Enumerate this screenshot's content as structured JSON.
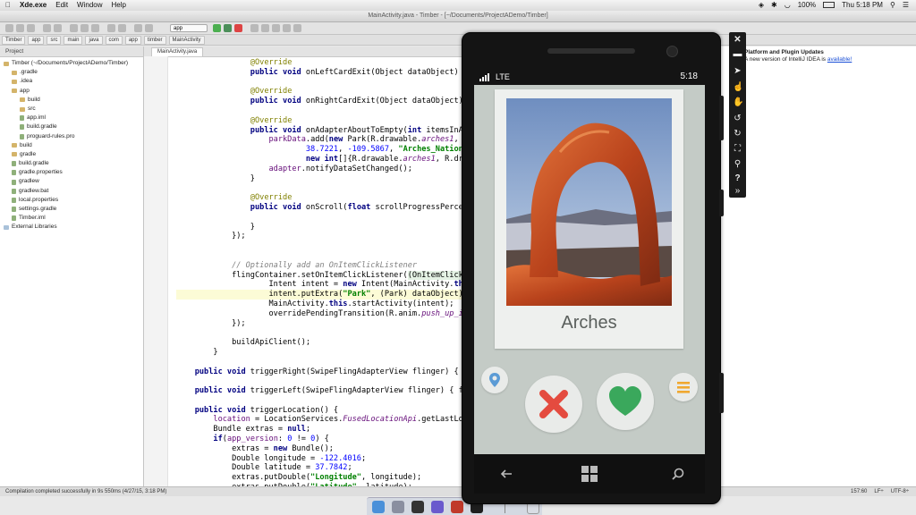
{
  "menubar": {
    "app_name": "Xde.exe",
    "menus": [
      "Edit",
      "Window",
      "Help"
    ],
    "battery": "100%",
    "clock": "Thu 5:18 PM"
  },
  "ide": {
    "window_title": "MainActivity.java - Timber - [~/Documents/ProjectADemo/Timber]",
    "run_config": "app",
    "breadcrumbs": [
      "Timber",
      "app",
      "src",
      "main",
      "java",
      "com",
      "app",
      "timber",
      "MainActivity"
    ],
    "project_panel_title": "Project",
    "project_tree": [
      {
        "label": "Timber (~/Documents/ProjectADemo/Timber)",
        "indent": 0,
        "kind": "folder"
      },
      {
        "label": ".gradle",
        "indent": 1,
        "kind": "folder"
      },
      {
        "label": ".idea",
        "indent": 1,
        "kind": "folder"
      },
      {
        "label": "app",
        "indent": 1,
        "kind": "folder"
      },
      {
        "label": "build",
        "indent": 2,
        "kind": "folder"
      },
      {
        "label": "src",
        "indent": 2,
        "kind": "folder"
      },
      {
        "label": "app.iml",
        "indent": 2,
        "kind": "file"
      },
      {
        "label": "build.gradle",
        "indent": 2,
        "kind": "file"
      },
      {
        "label": "proguard-rules.pro",
        "indent": 2,
        "kind": "file"
      },
      {
        "label": "build",
        "indent": 1,
        "kind": "folder"
      },
      {
        "label": "gradle",
        "indent": 1,
        "kind": "folder"
      },
      {
        "label": "build.gradle",
        "indent": 1,
        "kind": "file"
      },
      {
        "label": "gradle.properties",
        "indent": 1,
        "kind": "file"
      },
      {
        "label": "gradlew",
        "indent": 1,
        "kind": "file"
      },
      {
        "label": "gradlew.bat",
        "indent": 1,
        "kind": "file"
      },
      {
        "label": "local.properties",
        "indent": 1,
        "kind": "file"
      },
      {
        "label": "settings.gradle",
        "indent": 1,
        "kind": "file"
      },
      {
        "label": "Timber.iml",
        "indent": 1,
        "kind": "file"
      },
      {
        "label": "External Libraries",
        "indent": 0,
        "kind": "lib"
      }
    ],
    "editor_tab": "MainActivity.java",
    "notification": {
      "title": "Platform and Plugin Updates",
      "body_prefix": "A new version of IntelliJ IDEA is",
      "link": "available!"
    },
    "status_message": "Compilation completed successfully in 9s 550ms (4/27/15, 3:18 PM)",
    "status_position": "157:60",
    "status_line_sep": "LF÷",
    "status_encoding": "UTF-8÷"
  },
  "emulator": {
    "network": "LTE",
    "clock": "5:18",
    "card_title": "Arches"
  },
  "colors": {
    "reject": "#e44b3f",
    "like": "#3aa85c",
    "location": "#5b9bd5",
    "menu": "#f0a830"
  }
}
